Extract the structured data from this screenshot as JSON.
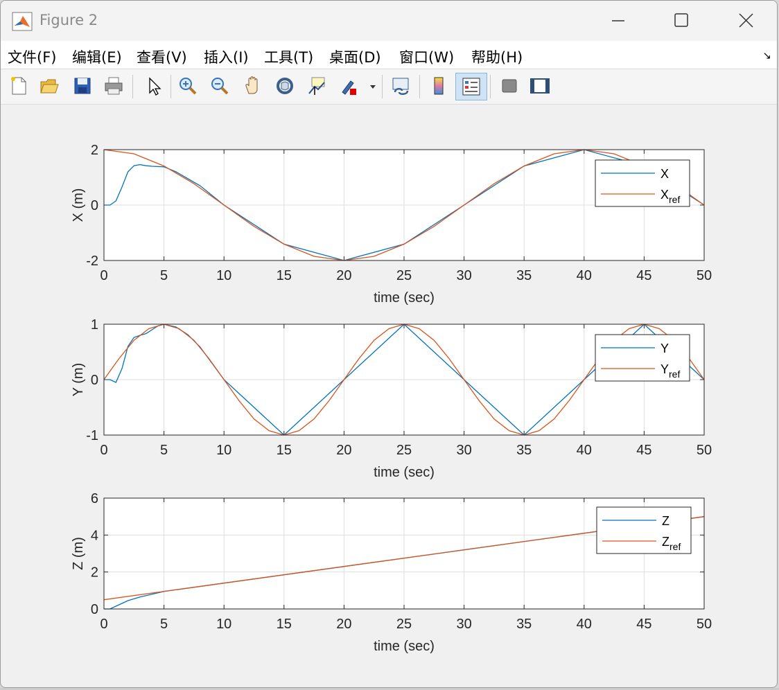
{
  "window": {
    "title": "Figure 2"
  },
  "menu": [
    "文件(F)",
    "编辑(E)",
    "查看(V)",
    "插入(I)",
    "工具(T)",
    "桌面(D)",
    "窗口(W)",
    "帮助(H)"
  ],
  "toolbar": {
    "items": [
      "new-figure-icon",
      "open-file-icon",
      "save-icon",
      "print-icon",
      "pointer-icon",
      "zoom-in-icon",
      "zoom-out-icon",
      "pan-hand-icon",
      "rotate-3d-icon",
      "data-cursor-icon",
      "brush-icon",
      "link-plot-icon",
      "colorbar-icon",
      "legend-icon",
      "hide-plot-tools-icon",
      "show-plot-tools-icon"
    ],
    "active": "legend-icon"
  },
  "colors": {
    "series_actual": "#0072BD",
    "series_ref": "#D95319"
  },
  "chart_data": [
    {
      "type": "line",
      "xlabel": "time (sec)",
      "ylabel": "X (m)",
      "xlim": [
        0,
        50
      ],
      "ylim": [
        -2,
        2
      ],
      "xticks": [
        "0",
        "5",
        "10",
        "15",
        "20",
        "25",
        "30",
        "35",
        "40",
        "45",
        "50"
      ],
      "yticks": [
        "-2",
        "0",
        "2"
      ],
      "grid": true,
      "legend": "top-right",
      "series": [
        {
          "name": "X",
          "x": [
            0,
            0.5,
            1,
            1.5,
            2,
            2.5,
            3,
            3.5,
            4,
            5,
            6,
            7,
            8,
            9,
            10,
            15,
            20,
            25,
            30,
            35,
            40,
            45,
            50
          ],
          "y": [
            0,
            0,
            0.15,
            0.65,
            1.2,
            1.42,
            1.46,
            1.42,
            1.4,
            1.38,
            1.2,
            0.95,
            0.7,
            0.35,
            0,
            -1.41,
            -2,
            -1.41,
            0,
            1.41,
            2,
            1.41,
            0
          ]
        },
        {
          "name": "X_ref",
          "x": [
            0,
            2.5,
            5,
            7.5,
            10,
            12.5,
            15,
            17.5,
            20,
            22.5,
            25,
            27.5,
            30,
            32.5,
            35,
            37.5,
            40,
            42.5,
            45,
            47.5,
            50
          ],
          "y": [
            2,
            1.85,
            1.41,
            0.77,
            0,
            -0.77,
            -1.41,
            -1.85,
            -2,
            -1.85,
            -1.41,
            -0.77,
            0,
            0.77,
            1.41,
            1.85,
            2,
            1.85,
            1.41,
            0.77,
            0
          ]
        }
      ],
      "legend_entries": [
        {
          "base": "X",
          "sub": ""
        },
        {
          "base": "X",
          "sub": "ref"
        }
      ]
    },
    {
      "type": "line",
      "xlabel": "time (sec)",
      "ylabel": "Y (m)",
      "xlim": [
        0,
        50
      ],
      "ylim": [
        -1,
        1
      ],
      "xticks": [
        "0",
        "5",
        "10",
        "15",
        "20",
        "25",
        "30",
        "35",
        "40",
        "45",
        "50"
      ],
      "yticks": [
        "-1",
        "0",
        "1"
      ],
      "grid": true,
      "legend": "top-right",
      "series": [
        {
          "name": "Y",
          "x": [
            0,
            0.5,
            1,
            1.5,
            2,
            2.5,
            3,
            3.5,
            4,
            4.5,
            5,
            6,
            7,
            8,
            10,
            15,
            20,
            25,
            30,
            35,
            40,
            45,
            50
          ],
          "y": [
            0,
            0,
            -0.05,
            0.2,
            0.6,
            0.76,
            0.8,
            0.83,
            0.9,
            0.97,
            1,
            0.95,
            0.81,
            0.59,
            0,
            -1,
            0,
            1,
            0,
            -1,
            0,
            1,
            0
          ]
        },
        {
          "name": "Y_ref",
          "x": [
            0,
            1.25,
            2.5,
            3.75,
            5,
            6.25,
            7.5,
            8.75,
            10,
            11.25,
            12.5,
            13.75,
            15,
            16.25,
            17.5,
            18.75,
            20,
            21.25,
            22.5,
            23.75,
            25,
            26.25,
            27.5,
            28.75,
            30,
            31.25,
            32.5,
            33.75,
            35,
            36.25,
            37.5,
            38.75,
            40,
            41.25,
            42.5,
            43.75,
            45,
            46.25,
            47.5,
            48.75,
            50
          ],
          "y": [
            0,
            0.38,
            0.71,
            0.92,
            1,
            0.92,
            0.71,
            0.38,
            0,
            -0.38,
            -0.71,
            -0.92,
            -1,
            -0.92,
            -0.71,
            -0.38,
            0,
            0.38,
            0.71,
            0.92,
            1,
            0.92,
            0.71,
            0.38,
            0,
            -0.38,
            -0.71,
            -0.92,
            -1,
            -0.92,
            -0.71,
            -0.38,
            0,
            0.38,
            0.71,
            0.92,
            1,
            0.92,
            0.71,
            0.38,
            0
          ]
        }
      ],
      "legend_entries": [
        {
          "base": "Y",
          "sub": ""
        },
        {
          "base": "Y",
          "sub": "ref"
        }
      ]
    },
    {
      "type": "line",
      "xlabel": "time (sec)",
      "ylabel": "Z (m)",
      "xlim": [
        0,
        50
      ],
      "ylim": [
        0,
        6
      ],
      "xticks": [
        "0",
        "5",
        "10",
        "15",
        "20",
        "25",
        "30",
        "35",
        "40",
        "45",
        "50"
      ],
      "yticks": [
        "0",
        "2",
        "4",
        "6"
      ],
      "grid": true,
      "legend": "top-right",
      "series": [
        {
          "name": "Z",
          "x": [
            0,
            0.5,
            1,
            1.5,
            2,
            3,
            4,
            5,
            10,
            20,
            30,
            40,
            50
          ],
          "y": [
            0,
            0,
            0.15,
            0.3,
            0.45,
            0.65,
            0.8,
            0.95,
            1.4,
            2.3,
            3.2,
            4.1,
            5.0
          ]
        },
        {
          "name": "Z_ref",
          "x": [
            0,
            50
          ],
          "y": [
            0.5,
            5.0
          ]
        }
      ],
      "legend_entries": [
        {
          "base": "Z",
          "sub": ""
        },
        {
          "base": "Z",
          "sub": "ref"
        }
      ]
    }
  ]
}
